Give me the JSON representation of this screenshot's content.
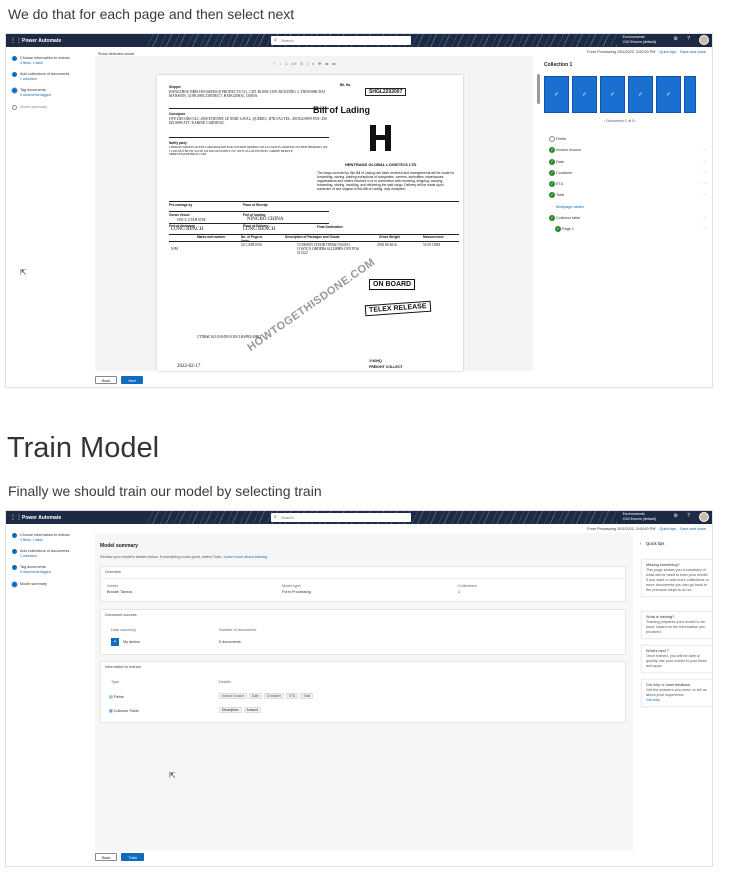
{
  "captions": {
    "first": "We do that for each page and then select next",
    "heading": "Train Model",
    "second": "Finally we should train our model by selecting train"
  },
  "app": {
    "name": "Power Automate",
    "search_placeholder": "Search",
    "env_label": "Environments",
    "env_name": "CWI Eworm (default)",
    "form_processing": "Form Processing 1/01/2022, 3:00:00 PM",
    "quick_tips": "Quick tips",
    "save_close": "Save and close"
  },
  "steps": [
    {
      "label": "Choose information to extract",
      "sub": "3 fields, 1 table"
    },
    {
      "label": "Add collections of documents",
      "sub": "1 collection"
    },
    {
      "label": "Tag documents",
      "sub": "5 documents tagged"
    },
    {
      "label": "Model summary",
      "sub": ""
    }
  ],
  "shot1": {
    "show_detected": "Show detected words",
    "page_tools": "↑ ↓ 1 of 5 | ⌕ ⊕ ▭ ▭",
    "collection_title": "Collection 1",
    "doc_nav": "‹ Document 1 of 5 ›",
    "fields_header": "Fields",
    "fields": [
      "Invoice Invoice",
      "Date",
      "Container",
      "ETA",
      "Total"
    ],
    "multipage": "Multipage tables",
    "tables_header": "Collector table",
    "page_item": "Page 1",
    "back": "Back",
    "next": "Next",
    "document": {
      "shipper_label": "Shipper",
      "shipper": "HANGZHOU BRIS HOUSEHOLD PRODUCTS CO., LTD. ROOM 1309, BUILDING 3, YIHANSHI DAI MANSION, GONGSHU DISTRICT, HANGZHOU, CHINA",
      "bl_no_label": "B/L No.",
      "bl_no": "SHGL2202007",
      "title": "Bill of Lading",
      "consignee_label": "Consignee",
      "consignee": "OVE DECORS ULC 2900 ETIENNE LE NOIR LAVAL, QUEBEC, H7R 0A3 TEL: 450 822 8899 FAX: 450 822 8899 ATT: KARINE CARDINAL",
      "notify_label": "Notify party",
      "notify": "LONDON WHOLESALERS CORPORATION FOR OUTSIDE ORDERS ON ACCOUNTS LIMITED OUTSIDE BROKERS INC 1 LINCOLN BLVD, SUITE 102 ROUSES POINT, NY 12979 USA ATTENTION: SABINE BERUTE, SBERUTE@METRICK.COM",
      "company": "HENTRANS GLOBAL LOGISTICS LTD",
      "terms": "The cargo covered by this Bill of Lading has been received and arrangements will be made for forwarding, storing, loading exceptions of companies, carriers, authorities, warehouses, organisations and others involved in or in connection with receiving, shipping, carrying, forwarding, storing, handling, and delivering the said cargo. Delivery will be made upon surrender of one original of this Bill of Lading, duly receipted.",
      "precarriage_label": "Pre-carriage by",
      "receipt_label": "Place of Receipt",
      "vessel_label": "Ocean Vessel",
      "vessel": "OOCL UTAH 055E",
      "loading_label": "Port of loading",
      "loading": "NINGBO CHINA",
      "discharge_label": "Port of discharge",
      "discharge": "LONG BEACH",
      "delivery_label": "Place of Delivery",
      "delivery": "LONG BEACH",
      "final_label": "Final Destination",
      "marks_label": "Marks and number",
      "pkgs_label": "No. of Pkgs or Units",
      "desc_label": "Description of Packages and Goods",
      "gross_label": "Gross Weight",
      "measure_label": "Measurement",
      "marks": "N/M",
      "pkgs": "52 CARTONS",
      "desc": "CUSHION CHAIR ITEM# 1502251 COSTCO ORDER# 612238809 OVE PO# 511222",
      "gross": "2955.80 KGS",
      "measure": "50.59 CBM",
      "stamp1": "ON BOARD",
      "stamp2": "TELEX RELEASE",
      "container": "CTNR#CSLU6194591/OOCLKSP82/40HQ",
      "container_size": "1*40HQ",
      "freight": "FREIGHT COLLECT",
      "date": "2022-02-17",
      "watermark": "HOWTOGETHISDONE.COM"
    }
  },
  "shot2": {
    "title": "Model summary",
    "desc": "Review your model's details below. If everything looks good, select Train.",
    "desc_link": "Learn more about training",
    "overview": "Overview",
    "owner_label": "Owner",
    "owner": "Brooke Tannos",
    "modeltype_label": "Model type",
    "modeltype": "Form Processing",
    "collections_label": "Collections",
    "collections": "1",
    "sources_header": "Document sources",
    "ds_label": "Data source(s)",
    "nd_label": "Number of documents",
    "ds_value": "My device",
    "nd_value": "5 documents",
    "extract_header": "Information to extract",
    "type_label": "Type",
    "details_label": "Details",
    "row1_type": "Fields",
    "row1_chips": [
      "Invoice Invoice",
      "Date",
      "Container",
      "ETA",
      "Total"
    ],
    "row2_type": "Collector Table",
    "row2_chips": [
      "Description",
      "Amount"
    ],
    "back": "Back",
    "train": "Train",
    "tips_title": "Quick tips",
    "tips": [
      {
        "title": "Missing something?",
        "body": "This page shows you a summary of what will be used to train your model. If you want to add more collections or more documents you can go back to the previous steps to do so."
      },
      {
        "title": "What is training?",
        "body": "Training prepares your model to be used, based on the information you provided."
      },
      {
        "title": "What's next ?",
        "body": "Once trained, you will be able to quickly use your model in your flows and apps."
      },
      {
        "title": "Got help or want feedback",
        "body": "Get the answers you need, or tell us about your experience.",
        "link": "Get help"
      }
    ]
  }
}
